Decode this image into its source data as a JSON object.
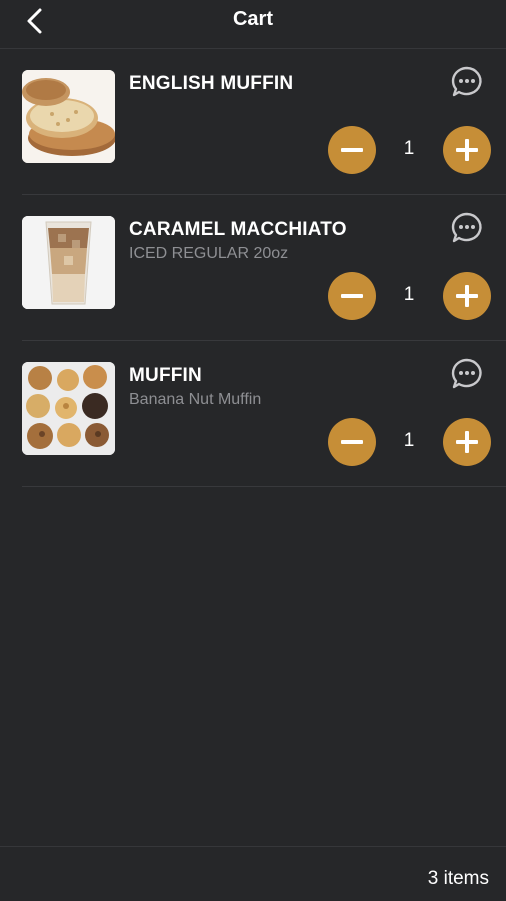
{
  "header": {
    "title": "Cart",
    "back_icon": "chevron-left-icon"
  },
  "items": [
    {
      "name": "ENGLISH MUFFIN",
      "detail": "",
      "quantity": "1",
      "image": "english-muffin-photo"
    },
    {
      "name": "CARAMEL MACCHIATO",
      "detail": "ICED REGULAR 20oz",
      "quantity": "1",
      "image": "iced-caramel-macchiato-photo"
    },
    {
      "name": "MUFFIN",
      "detail": "Banana Nut Muffin",
      "quantity": "1",
      "image": "muffins-assortment-photo"
    }
  ],
  "footer": {
    "count_label": "3 items"
  },
  "colors": {
    "background": "#262729",
    "accent": "#c68e37",
    "text_primary": "#ffffff",
    "text_secondary": "#8e8f93",
    "divider": "#38393c"
  }
}
